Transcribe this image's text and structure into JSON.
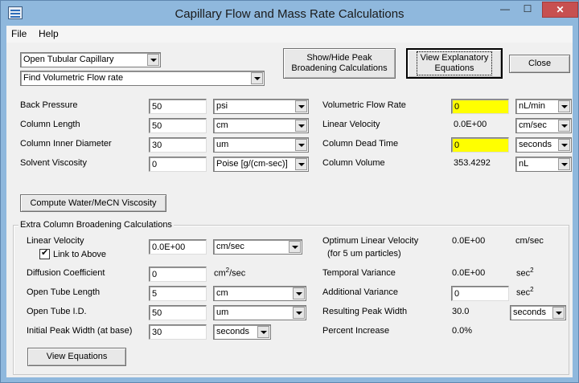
{
  "window": {
    "title": "Capillary Flow and Mass Rate Calculations",
    "controls": {
      "minimize": "—",
      "maximize": "☐",
      "close": "✕"
    }
  },
  "menu": {
    "file": "File",
    "help": "Help"
  },
  "top": {
    "capillary_type": "Open Tubular Capillary",
    "calc_mode": "Find Volumetric Flow rate",
    "show_hide_label_1": "Show/Hide Peak",
    "show_hide_label_2": "Broadening Calculations",
    "view_eq_label_1": "View Explanatory",
    "view_eq_label_2": "Equations",
    "close_label": "Close"
  },
  "left": {
    "back_pressure": {
      "label": "Back Pressure",
      "value": "50",
      "unit": "psi"
    },
    "column_length": {
      "label": "Column Length",
      "value": "50",
      "unit": "cm"
    },
    "column_id": {
      "label": "Column Inner Diameter",
      "value": "30",
      "unit": "um"
    },
    "solvent_viscosity": {
      "label": "Solvent Viscosity",
      "value": "0",
      "unit": "Poise [g/(cm-sec)]"
    }
  },
  "right": {
    "vol_flow": {
      "label": "Volumetric Flow Rate",
      "value": "0",
      "unit": "nL/min"
    },
    "linear_velocity": {
      "label": "Linear Velocity",
      "value": "0.0E+00",
      "unit": "cm/sec"
    },
    "dead_time": {
      "label": "Column Dead Time",
      "value": "0",
      "unit": "seconds"
    },
    "column_volume": {
      "label": "Column Volume",
      "value": "353.4292",
      "unit": "nL"
    }
  },
  "compute_button": "Compute Water/MeCN Viscosity",
  "extra": {
    "group_title": "Extra Column Broadening Calculations",
    "linear_velocity": {
      "label": "Linear Velocity",
      "value": "0.0E+00",
      "unit": "cm/sec"
    },
    "link_label": "Link to Above",
    "diffusion": {
      "label": "Diffusion Coefficient",
      "value": "0",
      "unit": "cm",
      "unit_sup": "2",
      "unit_suffix": "/sec"
    },
    "tube_length": {
      "label": "Open Tube Length",
      "value": "5",
      "unit": "cm"
    },
    "tube_id": {
      "label": "Open Tube I.D.",
      "value": "50",
      "unit": "um"
    },
    "peak_width": {
      "label": "Initial Peak Width (at base)",
      "value": "30",
      "unit": "seconds"
    },
    "opt_lin_vel": {
      "label": "Optimum Linear Velocity",
      "sub": "(for 5 um particles)",
      "value": "0.0E+00",
      "unit": "cm/sec"
    },
    "temporal_var": {
      "label": "Temporal Variance",
      "value": "0.0E+00",
      "unit": "sec",
      "unit_sup": "2"
    },
    "additional_var": {
      "label": "Additional Variance",
      "value": "0",
      "unit": "sec",
      "unit_sup": "2"
    },
    "resulting_width": {
      "label": "Resulting Peak Width",
      "value": "30.0",
      "unit": "seconds"
    },
    "percent_increase": {
      "label": "Percent Increase",
      "value": "0.0%"
    },
    "view_equations": "View Equations"
  }
}
